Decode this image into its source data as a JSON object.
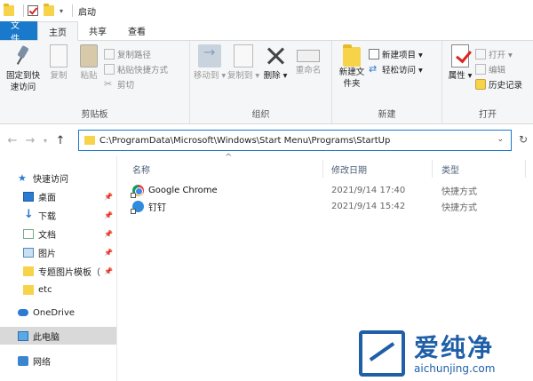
{
  "window": {
    "title": "启动"
  },
  "tabs": [
    {
      "label": "文件"
    },
    {
      "label": "主页"
    },
    {
      "label": "共享"
    },
    {
      "label": "查看"
    }
  ],
  "ribbon": {
    "clipboard": {
      "pin_label": "固定到快速访问",
      "copy_label": "复制",
      "paste_label": "粘贴",
      "copy_path_label": "复制路径",
      "paste_shortcut_label": "粘贴快捷方式",
      "cut_label": "剪切",
      "group_label": "剪贴板"
    },
    "organize": {
      "move_to_label": "移动到",
      "copy_to_label": "复制到",
      "delete_label": "删除",
      "rename_label": "重命名",
      "group_label": "组织"
    },
    "new": {
      "new_folder_label": "新建文件夹",
      "new_item_label": "新建项目",
      "easy_access_label": "轻松访问",
      "group_label": "新建"
    },
    "open": {
      "properties_label": "属性",
      "open_label": "打开",
      "edit_label": "编辑",
      "history_label": "历史记录",
      "group_label": "打开"
    }
  },
  "address": {
    "path": "C:\\ProgramData\\Microsoft\\Windows\\Start Menu\\Programs\\StartUp"
  },
  "sidebar": {
    "items": [
      {
        "label": "快速访问",
        "icon": "star-icon"
      },
      {
        "label": "桌面",
        "icon": "desktop-icon",
        "pinned": true
      },
      {
        "label": "下载",
        "icon": "download-icon",
        "pinned": true
      },
      {
        "label": "文档",
        "icon": "documents-icon",
        "pinned": true
      },
      {
        "label": "图片",
        "icon": "pictures-icon",
        "pinned": true
      },
      {
        "label": "专题图片模板（",
        "icon": "folder-icon",
        "pinned": true
      },
      {
        "label": "etc",
        "icon": "folder-icon"
      },
      {
        "label": "OneDrive",
        "icon": "onedrive-icon"
      },
      {
        "label": "此电脑",
        "icon": "this-pc-icon",
        "selected": true
      },
      {
        "label": "网络",
        "icon": "network-icon"
      }
    ]
  },
  "columns": {
    "name": "名称",
    "modified": "修改日期",
    "type": "类型"
  },
  "files": [
    {
      "name": "Google Chrome",
      "modified": "2021/9/14 17:40",
      "type": "快捷方式",
      "icon": "chrome-icon"
    },
    {
      "name": "钉钉",
      "modified": "2021/9/14 15:42",
      "type": "快捷方式",
      "icon": "dingtalk-icon"
    }
  ],
  "watermark": {
    "title": "爱纯净",
    "url": "aichunjing.com"
  },
  "colors": {
    "accent": "#1979ca",
    "ribbon_bg": "#f5f6f7",
    "selected_bg": "#d9d9d9"
  }
}
